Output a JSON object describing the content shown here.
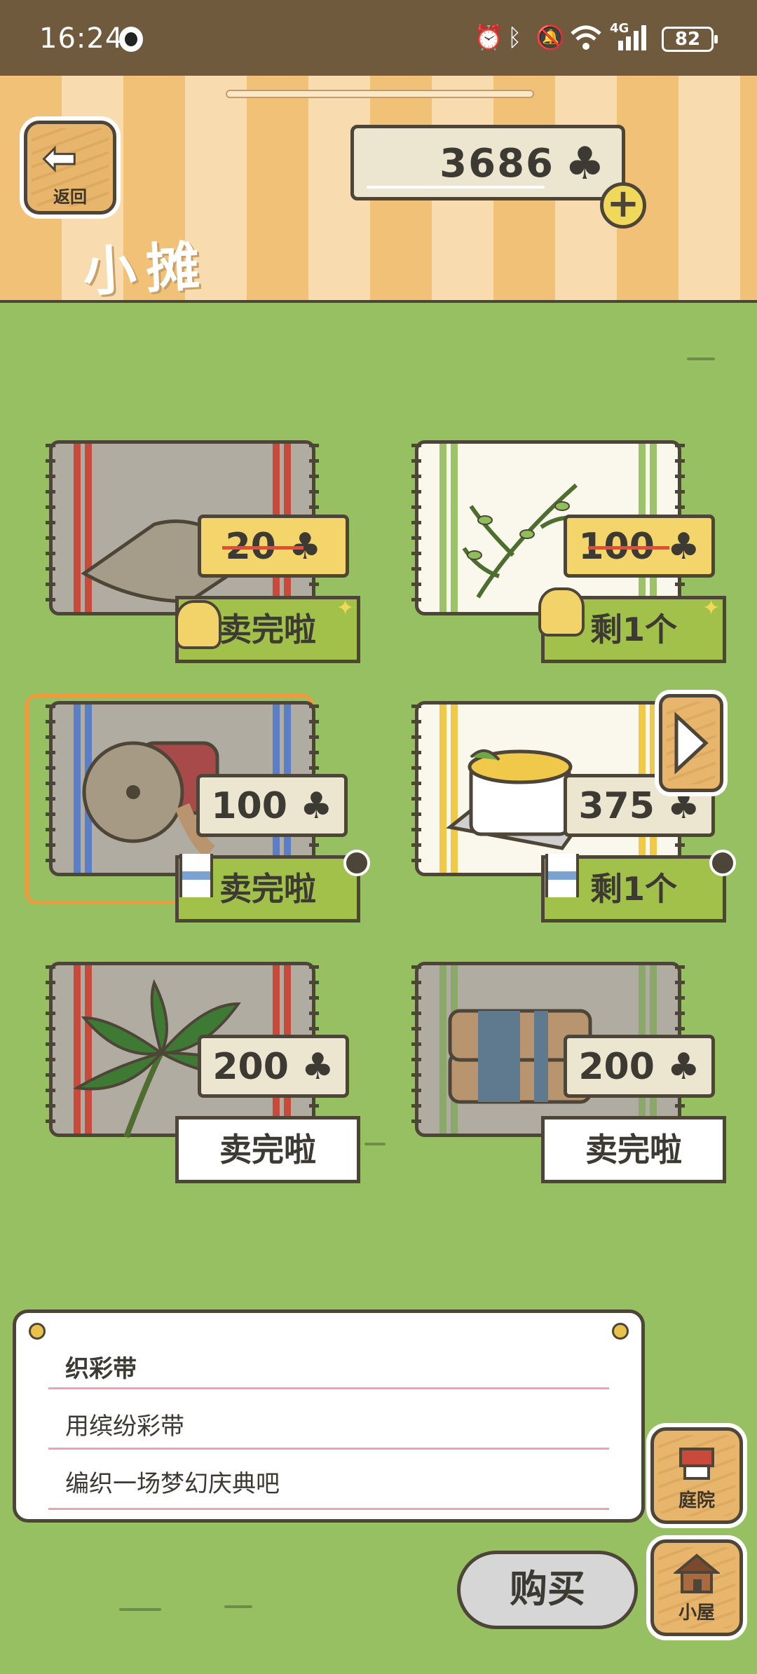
{
  "status_bar": {
    "time": "16:24",
    "network": "4G",
    "battery": "82",
    "icons": [
      "qq-icon",
      "alarm-icon",
      "bluetooth-icon",
      "mute-icon",
      "wifi-icon",
      "signal-icon",
      "battery-icon"
    ]
  },
  "header": {
    "back_label": "返回",
    "title": "小摊",
    "currency_amount": "3686",
    "currency_icon": "clover-icon",
    "add_icon": "plus-icon"
  },
  "items": [
    {
      "name": "sack",
      "price": "20",
      "price_struck": true,
      "status": "卖完啦",
      "badge": "bell-icon",
      "tag_color": "#f3d56c",
      "status_style": "green",
      "cloth_color": "#b1aca2",
      "stripe_color": "#c84a3a"
    },
    {
      "name": "herb",
      "price": "100",
      "price_struck": true,
      "status": "剩1个",
      "badge": "bell-icon",
      "tag_color": "#f3d56c",
      "status_style": "green",
      "cloth_color": "#faf7ec",
      "stripe_color": "#9cc36a"
    },
    {
      "name": "ribbon-spool",
      "price": "100",
      "price_struck": false,
      "status": "卖完啦",
      "badge": "hourglass-icon",
      "tag_color": "#ece5d0",
      "status_style": "green",
      "cloth_color": "#b1aca2",
      "stripe_color": "#5a7fc6",
      "selected": true
    },
    {
      "name": "soup-pot",
      "price": "375",
      "price_struck": false,
      "status": "剩1个",
      "badge": "hourglass-icon",
      "tag_color": "#ece5d0",
      "status_style": "green",
      "cloth_color": "#faf7ec",
      "stripe_color": "#f0c94a"
    },
    {
      "name": "palm-leaf",
      "price": "200",
      "price_struck": false,
      "status": "卖完啦",
      "badge": "",
      "tag_color": "#ece5d0",
      "status_style": "white",
      "cloth_color": "#b1aca2",
      "stripe_color": "#c84a3a"
    },
    {
      "name": "folded-cloth",
      "price": "200",
      "price_struck": false,
      "status": "卖完啦",
      "badge": "",
      "tag_color": "#ece5d0",
      "status_style": "white",
      "cloth_color": "#b1aca2",
      "stripe_color": "#8aa86a"
    }
  ],
  "info": {
    "item_name": "织彩带",
    "line1": "用缤纷彩带",
    "line2": "编织一场梦幻庆典吧"
  },
  "buttons": {
    "buy": "购买",
    "yard": "庭院",
    "house": "小屋"
  },
  "colors": {
    "grass": "#97c062",
    "outline": "#4d4537",
    "selection": "#f09a3c",
    "status_green": "#a2c14a"
  }
}
